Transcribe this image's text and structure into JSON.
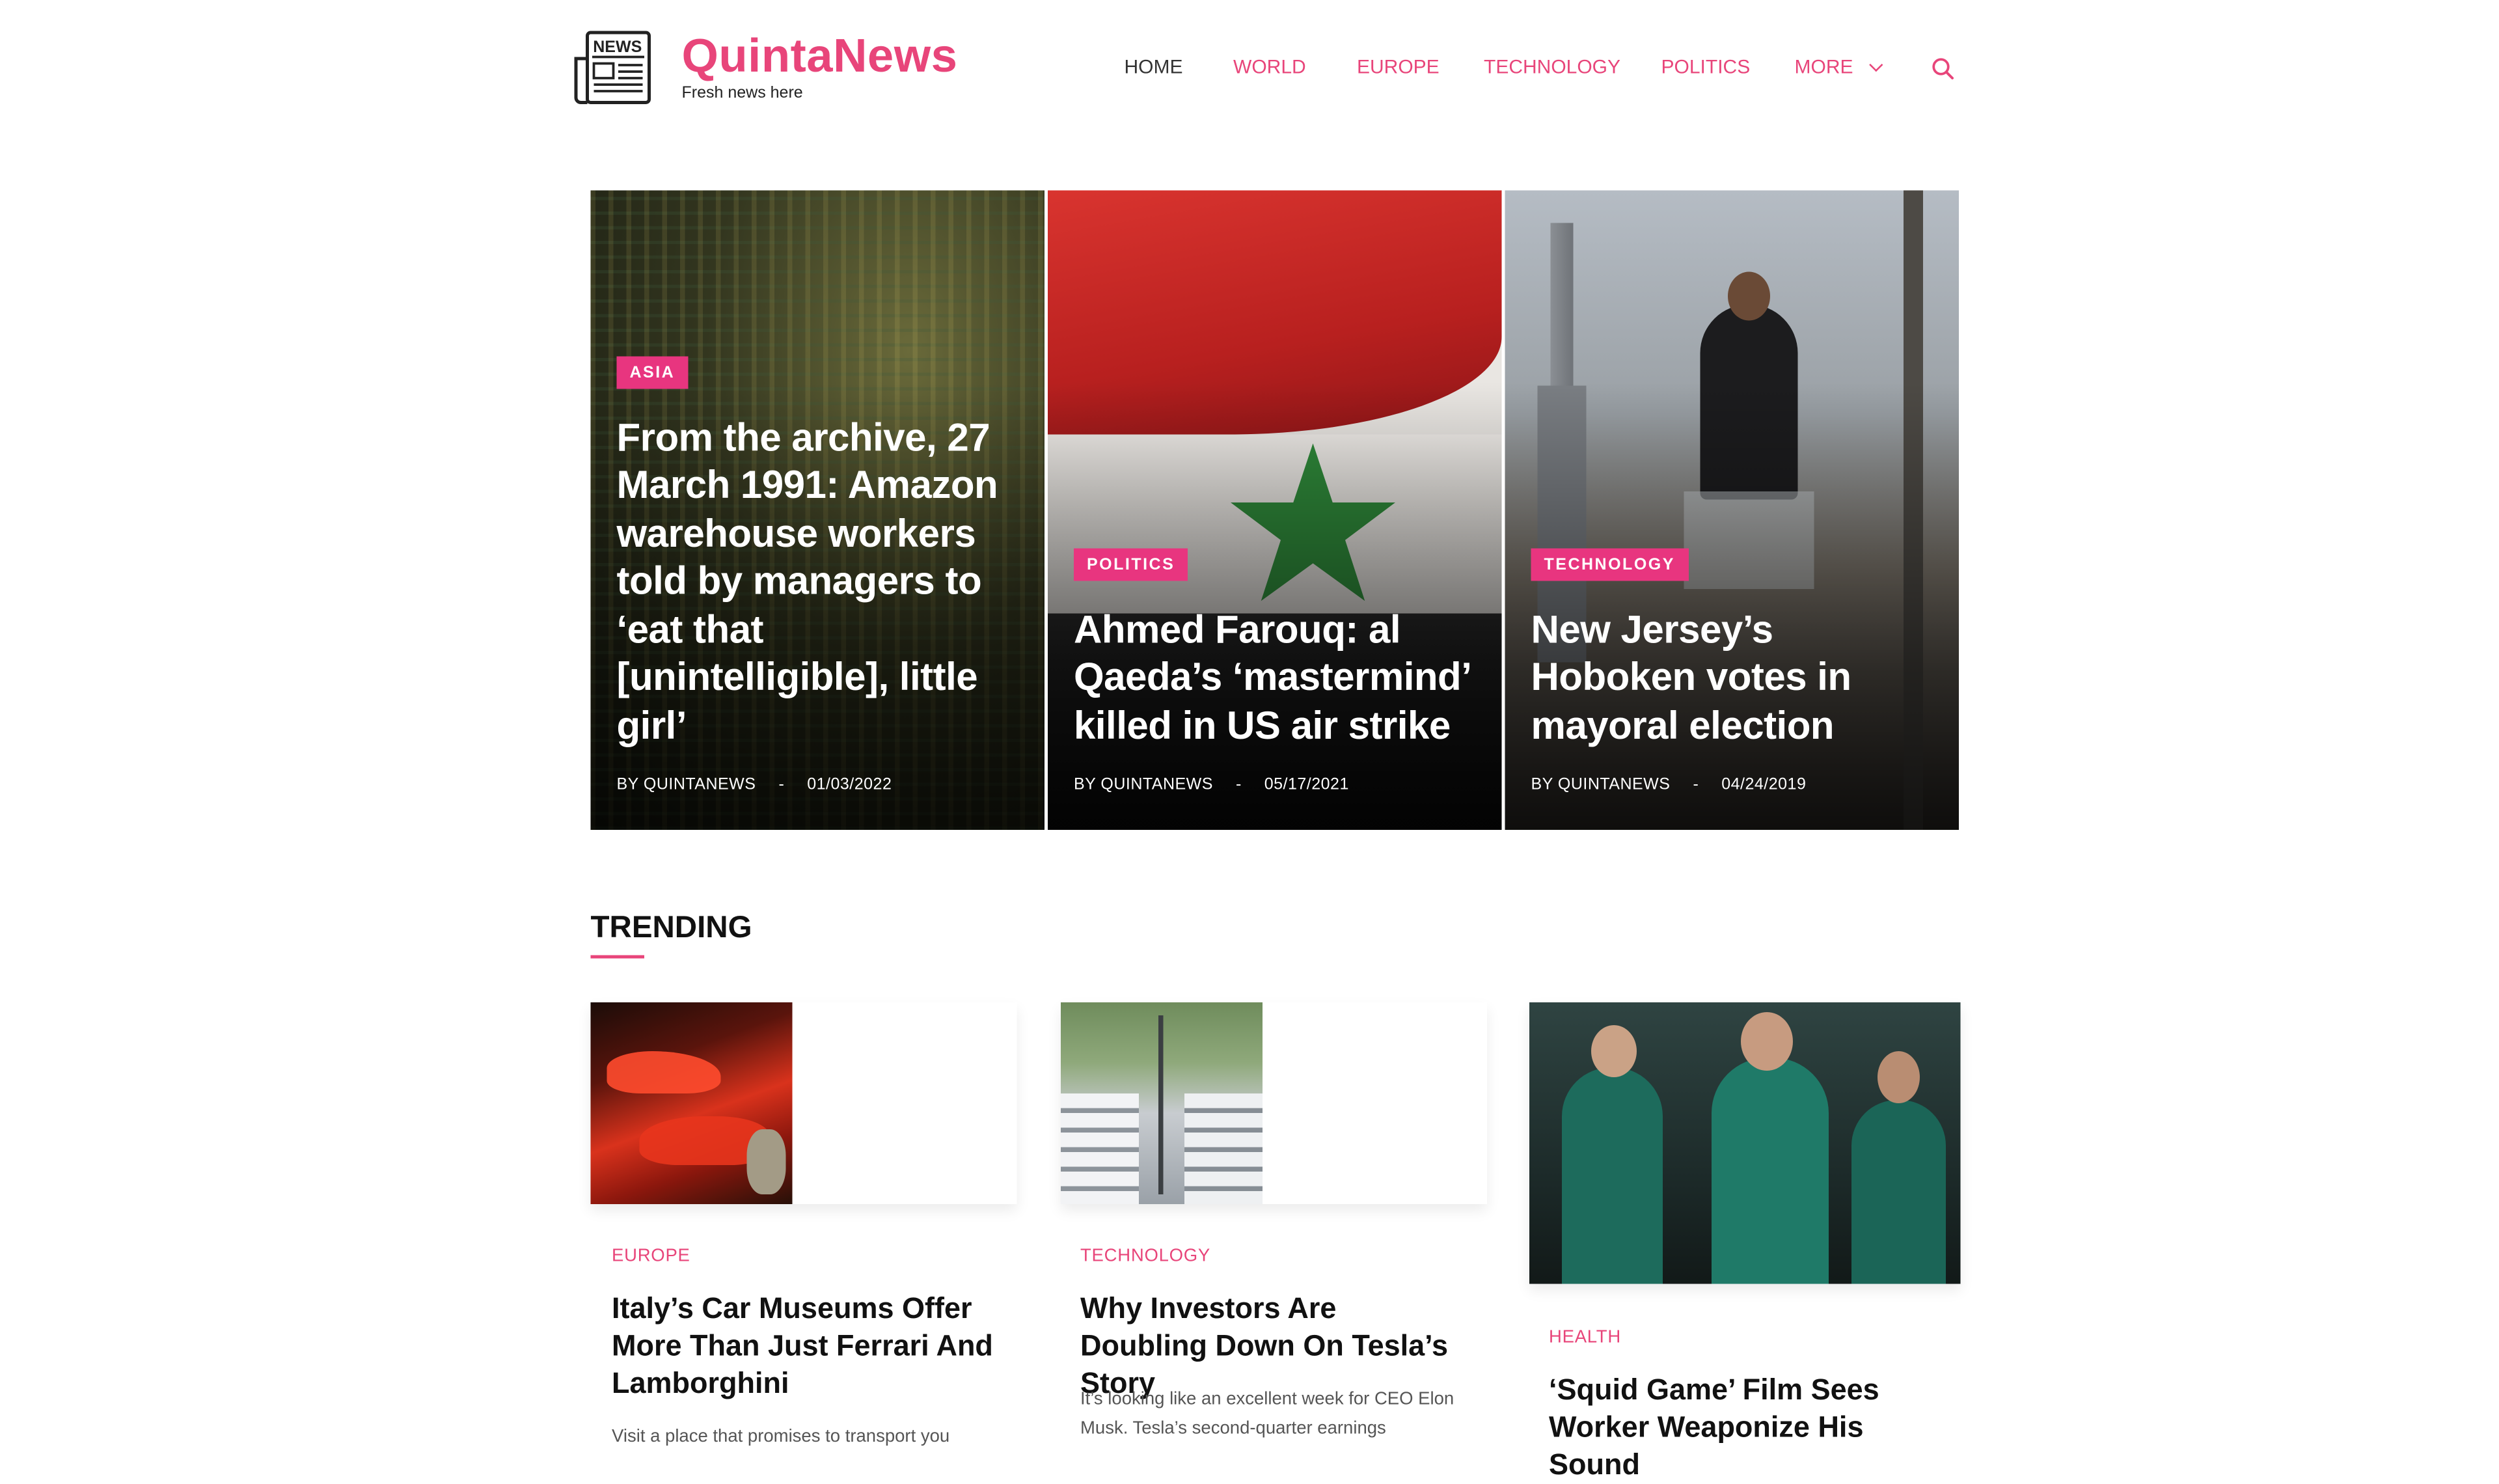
{
  "header": {
    "brand": "QuintaNews",
    "tagline": "Fresh news here",
    "nav": [
      "HOME",
      "WORLD",
      "EUROPE",
      "TECHNOLOGY",
      "POLITICS",
      "MORE"
    ]
  },
  "hero": [
    {
      "category": "ASIA",
      "title": "From the archive, 27 March 1991: Amazon warehouse workers told by managers to ‘eat that [unintelligible], little girl’",
      "by": "BY",
      "author": "QUINTANEWS",
      "sep": "-",
      "date": "01/03/2022"
    },
    {
      "category": "POLITICS",
      "title": "Ahmed Farouq: al Qaeda’s ‘mastermind’ killed in US air strike",
      "by": "BY",
      "author": "QUINTANEWS",
      "sep": "-",
      "date": "05/17/2021"
    },
    {
      "category": "TECHNOLOGY",
      "title": "New Jersey’s Hoboken votes in mayoral election",
      "by": "BY",
      "author": "QUINTANEWS",
      "sep": "-",
      "date": "04/24/2019"
    }
  ],
  "trending": {
    "title": "TRENDING",
    "cards": [
      {
        "category": "EUROPE",
        "title": "Italy’s Car Museums Offer More Than Just Ferrari And Lamborghini",
        "excerpt": "Visit a place that promises to transport you"
      },
      {
        "category": "TECHNOLOGY",
        "title": "Why Investors Are Doubling Down On Tesla’s Story",
        "excerpt": "It’s looking like an excellent week for CEO Elon Musk. Tesla’s second-quarter earnings"
      },
      {
        "category": "HEALTH",
        "title": "‘Squid Game’ Film Sees Worker Weaponize His Sound",
        "excerpt": ""
      }
    ]
  },
  "colors": {
    "accent": "#e8457a",
    "badge": "#e8357f"
  }
}
